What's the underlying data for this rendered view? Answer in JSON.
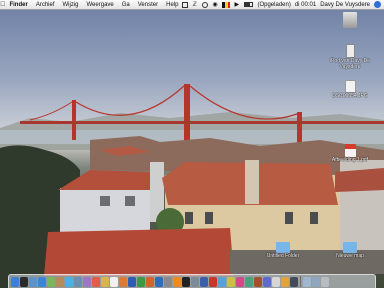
{
  "menubar": {
    "apple_icon": "apple-icon",
    "menus": [
      "Finder",
      "Archief",
      "Wijzig",
      "Weergave",
      "Ga",
      "Venster",
      "Help"
    ],
    "status": {
      "battery_text": "(Opgeladen)",
      "clock": "di 00:01",
      "user": "Davy De Vuysdere"
    }
  },
  "desktop_icons": [
    {
      "name": "hard-disk-icon",
      "label": "",
      "color": "#c9c9c9"
    },
    {
      "name": "ipod-icon",
      "label": "iPod van Davy De Vuysdere",
      "color": "#e8e8e8"
    },
    {
      "name": "file-icon",
      "label": "DSC00054.JPG",
      "color": "#f2f2f2"
    },
    {
      "name": "pdf-icon",
      "label": "Afbeelding 1.pdf",
      "color": "#d83a2c"
    },
    {
      "name": "folder-icon",
      "label": "Nieuwe map",
      "color": "#78b6ea"
    },
    {
      "name": "folder-icon",
      "label": "Untitled Folder",
      "color": "#78b6ea"
    }
  ],
  "dock": {
    "items": [
      {
        "name": "finder-icon",
        "color": "#3c7fd8"
      },
      {
        "name": "dashboard-icon",
        "color": "#2b2b2b"
      },
      {
        "name": "mail-icon",
        "color": "#5f92c9"
      },
      {
        "name": "safari-icon",
        "color": "#3a86d6"
      },
      {
        "name": "ichat-icon",
        "color": "#7ab65a"
      },
      {
        "name": "address-book-icon",
        "color": "#b58b5c"
      },
      {
        "name": "itunes-icon",
        "color": "#4bb0e6"
      },
      {
        "name": "iphoto-icon",
        "color": "#6a8fb5"
      },
      {
        "name": "imovie-icon",
        "color": "#9c77c6"
      },
      {
        "name": "ical-icon",
        "color": "#e55b4a"
      },
      {
        "name": "preview-icon",
        "color": "#d9b44a"
      },
      {
        "name": "textedit-icon",
        "color": "#f0f0f0"
      },
      {
        "name": "firefox-icon",
        "color": "#e07a2e"
      },
      {
        "name": "word-icon",
        "color": "#2e5db3"
      },
      {
        "name": "excel-icon",
        "color": "#3a9a45"
      },
      {
        "name": "powerpoint-icon",
        "color": "#d7632c"
      },
      {
        "name": "photoshop-icon",
        "color": "#2d6fb7"
      },
      {
        "name": "utility-icon",
        "color": "#8a8a8a"
      },
      {
        "name": "vlc-icon",
        "color": "#f08a1c"
      },
      {
        "name": "terminal-icon",
        "color": "#222222"
      },
      {
        "name": "system-preferences-icon",
        "color": "#7e8c9a"
      },
      {
        "name": "quicktime-icon",
        "color": "#3d5fa8"
      },
      {
        "name": "acrobat-icon",
        "color": "#c8372b"
      },
      {
        "name": "app-icon",
        "color": "#5aa0d8"
      },
      {
        "name": "app-icon",
        "color": "#c7c14a"
      },
      {
        "name": "app-icon",
        "color": "#d24a8a"
      },
      {
        "name": "app-icon",
        "color": "#4aa37b"
      },
      {
        "name": "app-icon",
        "color": "#a0522d"
      },
      {
        "name": "app-icon",
        "color": "#5d6bd0"
      },
      {
        "name": "app-icon",
        "color": "#d6d6d6"
      },
      {
        "name": "app-icon",
        "color": "#e3a13b"
      },
      {
        "name": "app-icon",
        "color": "#444b59"
      }
    ],
    "trailing": [
      {
        "name": "documents-stack-icon",
        "color": "#9fb8cf"
      },
      {
        "name": "downloads-stack-icon",
        "color": "#8fa7be"
      },
      {
        "name": "trash-icon",
        "color": "#b7bcc2"
      }
    ]
  },
  "colors": {
    "menubar_bg": "#eeeeee",
    "bridge_red": "#b6352a",
    "sky_top": "#6c7ea4"
  }
}
